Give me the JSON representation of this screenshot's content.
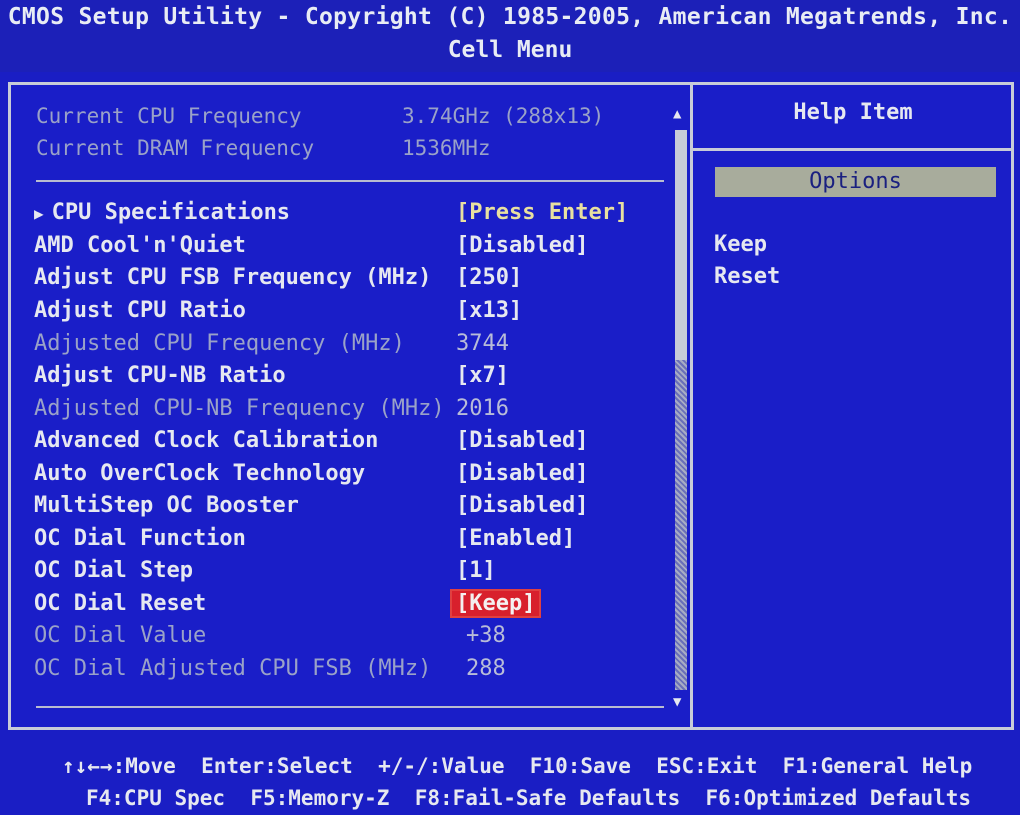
{
  "header": {
    "title": "CMOS Setup Utility - Copyright (C) 1985-2005, American Megatrends, Inc.",
    "subtitle": "Cell Menu"
  },
  "info": {
    "cpu_freq_label": "Current CPU Frequency",
    "cpu_freq_value": "3.74GHz (288x13)",
    "dram_freq_label": "Current DRAM Frequency",
    "dram_freq_value": "1536MHz"
  },
  "items": [
    {
      "label": "CPU Specifications",
      "value": "[Press Enter]",
      "submenu": true
    },
    {
      "label": "AMD Cool'n'Quiet",
      "value": "[Disabled]"
    },
    {
      "label": "Adjust CPU FSB Frequency (MHz)",
      "value": "[250]"
    },
    {
      "label": "Adjust CPU Ratio",
      "value": "[x13]"
    },
    {
      "label": "Adjusted CPU Frequency (MHz)",
      "value": "3744",
      "readonly": true
    },
    {
      "label": "Adjust CPU-NB Ratio",
      "value": "[x7]"
    },
    {
      "label": "Adjusted CPU-NB Frequency (MHz)",
      "value": "2016",
      "readonly": true
    },
    {
      "label": "Advanced Clock Calibration",
      "value": "[Disabled]"
    },
    {
      "label": "Auto OverClock Technology",
      "value": "[Disabled]"
    },
    {
      "label": "MultiStep OC Booster",
      "value": "[Disabled]"
    },
    {
      "label": "OC Dial Function",
      "value": "[Enabled]"
    },
    {
      "label": "OC Dial Step",
      "value": "[1]"
    },
    {
      "label": "OC Dial Reset",
      "value": "[Keep]",
      "selected": true
    },
    {
      "label": "OC Dial Value",
      "value": "+38",
      "readonly": true
    },
    {
      "label": "OC Dial Adjusted CPU FSB (MHz)",
      "value": "288",
      "readonly": true
    }
  ],
  "help": {
    "title": "Help Item",
    "options_label": "Options",
    "options": [
      "Keep",
      "Reset"
    ]
  },
  "footer": {
    "line1": "↑↓←→:Move  Enter:Select  +/-/:Value  F10:Save  ESC:Exit  F1:General Help",
    "line2": "F4:CPU Spec  F5:Memory-Z  F8:Fail-Safe Defaults  F6:Optimized Defaults"
  },
  "colors": {
    "background": "#1a1ec4",
    "selected": "#d8202c",
    "value_highlight": "#e8e0a0"
  }
}
